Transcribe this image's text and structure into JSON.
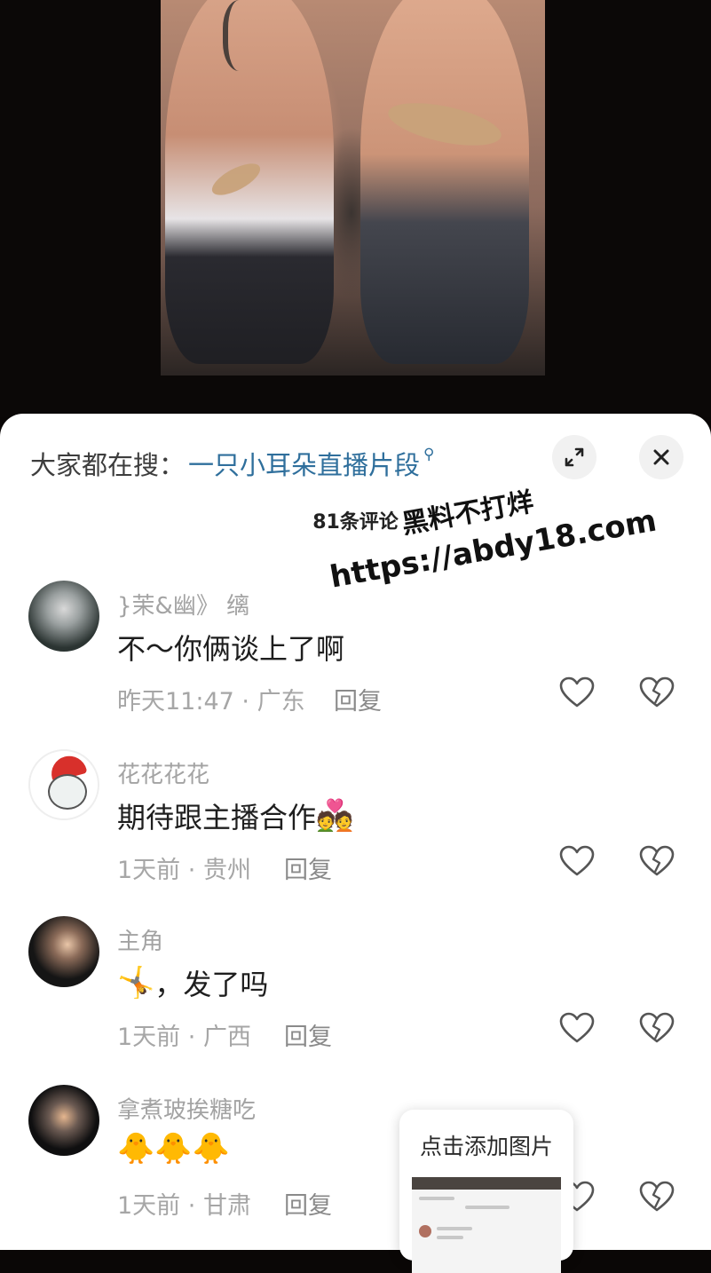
{
  "search": {
    "prefix": "大家都在搜：",
    "query": "一只小耳朵直播片段",
    "icon": "search-icon"
  },
  "header": {
    "comment_count": "81条评论",
    "expand_icon": "expand-icon",
    "close_icon": "close-icon"
  },
  "comments": [
    {
      "user": "}茉&幽》 缡",
      "text": "不～你俩谈上了啊",
      "emoji": "",
      "time": "昨天11:47",
      "location": "广东",
      "reply": "回复"
    },
    {
      "user": "花花花花",
      "text": "期待跟主播合作",
      "emoji": "💑",
      "time": "1天前",
      "location": "贵州",
      "reply": "回复"
    },
    {
      "user": "主角",
      "text": "，发了吗",
      "emoji": "🤸",
      "time": "1天前",
      "location": "广西",
      "reply": "回复"
    },
    {
      "user": "拿煮玻挨糖吃",
      "text": "",
      "emoji": "🐥🐥🐥",
      "time": "1天前",
      "location": "甘肃",
      "reply": "回复"
    }
  ],
  "add_image": {
    "label": "点击添加图片"
  },
  "watermark": {
    "line1": "黑料不打烊",
    "line2": "https://abdy18.com"
  },
  "colors": {
    "link": "#2f6f9c",
    "meta": "#a6a6a6",
    "sheet": "#ffffff",
    "background": "#0a0706"
  }
}
